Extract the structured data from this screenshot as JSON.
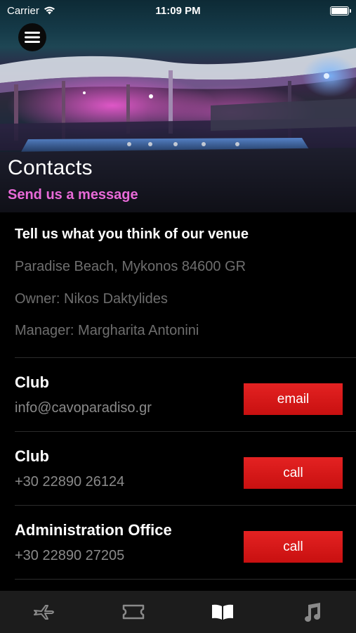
{
  "status_bar": {
    "carrier": "Carrier",
    "time": "11:09 PM",
    "battery_level": 1.0
  },
  "header": {
    "menu_icon": "hamburger-menu-icon",
    "title": "Contacts",
    "subtitle": "Send us a message"
  },
  "intro": {
    "heading": "Tell us what you think of our venue",
    "address": "Paradise Beach, Mykonos 84600 GR",
    "owner": "Owner: Nikos Daktylides",
    "manager": "Manager: Margharita Antonini"
  },
  "contacts": [
    {
      "name": "Club",
      "detail": "info@cavoparadiso.gr",
      "action": "email"
    },
    {
      "name": "Club",
      "detail": "+30 22890 26124",
      "action": "call"
    },
    {
      "name": "Administration Office",
      "detail": "+30 22890 27205",
      "action": "call"
    }
  ],
  "tabs": [
    {
      "icon": "airplane-icon",
      "active": false
    },
    {
      "icon": "ticket-icon",
      "active": false
    },
    {
      "icon": "open-book-icon",
      "active": true
    },
    {
      "icon": "music-note-icon",
      "active": false
    }
  ],
  "colors": {
    "accent_pink": "#e86ad8",
    "button_red": "#d41818",
    "tab_bar_bg": "#1c1c1c",
    "muted_text": "#6e6e6e"
  }
}
